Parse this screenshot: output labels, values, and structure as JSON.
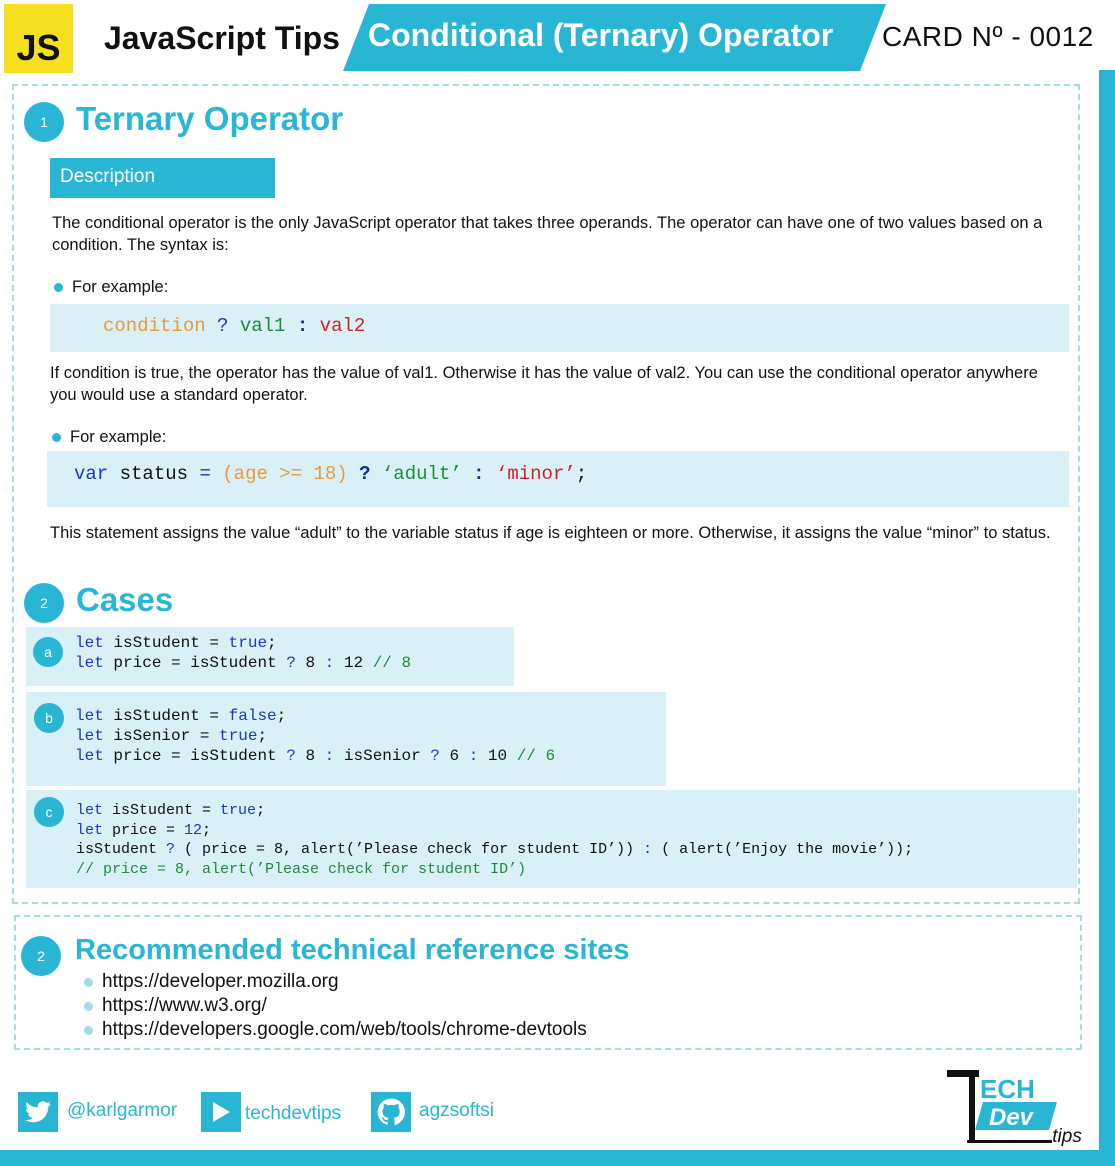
{
  "header": {
    "badge": "JS",
    "series": "JavaScript Tips",
    "topic": "Conditional (Ternary) Operator",
    "card_number": "CARD Nº - 0012"
  },
  "section1": {
    "number": "1",
    "title": "Ternary Operator",
    "desc_label": "Description",
    "para1": "The conditional operator is the only JavaScript operator that takes three operands. The operator can have one of two values based on a condition. The syntax is:",
    "example_label_1": "For example:",
    "syntax": {
      "cond": "condition",
      "q": "?",
      "v1": "val1",
      "colon": ":",
      "v2": "val2"
    },
    "para2": "If condition is true, the operator has the value of val1. Otherwise it has the value of val2. You can use the conditional operator anywhere you would use a standard operator.",
    "example_label_2": "For example:",
    "example": {
      "kw": "var",
      "name": "status",
      "eq": "=",
      "cond": "(age >= 18)",
      "q": "?",
      "v1": "‘adult’",
      "colon": ":",
      "v2": "‘minor’",
      "semi": ";"
    },
    "para3": "This statement assigns the value “adult” to the variable status if age is eighteen or more. Otherwise, it assigns the value “minor” to status."
  },
  "section2": {
    "number": "2",
    "title": "Cases",
    "cases": [
      {
        "letter": "a"
      },
      {
        "letter": "b"
      },
      {
        "letter": "c"
      }
    ]
  },
  "refs": {
    "number": "2",
    "title": "Recommended technical reference sites",
    "items": [
      "https://developer.mozilla.org",
      "https://www.w3.org/",
      "https://developers.google.com/web/tools/chrome-devtools"
    ]
  },
  "footer": {
    "twitter": "@karlgarmor",
    "youtube": "techdevtips",
    "github": "agzsoftsi"
  },
  "logo": {
    "tech": "ECH",
    "t": "T",
    "dev": "Dev",
    "tips": ".tips"
  },
  "colors": {
    "accent": "#29b6d4",
    "code_bg": "#d9f1f6",
    "js_yellow": "#f5df1e"
  }
}
